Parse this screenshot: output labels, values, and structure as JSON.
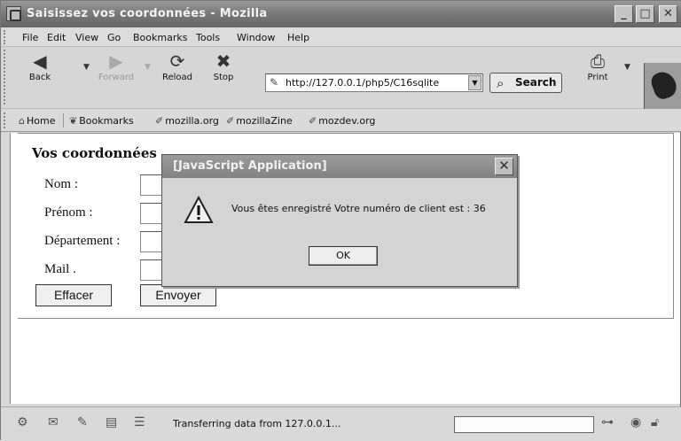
{
  "window": {
    "title": "Saisissez vos coordonnées - Mozilla"
  },
  "menu": {
    "items": [
      "File",
      "Edit",
      "View",
      "Go",
      "Bookmarks",
      "Tools",
      "Window",
      "Help"
    ]
  },
  "toolbar": {
    "back": "Back",
    "forward": "Forward",
    "reload": "Reload",
    "stop": "Stop",
    "url": "http://127.0.0.1/php5/C16sqlite",
    "search": "Search",
    "print": "Print"
  },
  "personal": {
    "items": [
      "Home",
      "Bookmarks",
      "mozilla.org",
      "mozillaZine",
      "mozdev.org"
    ]
  },
  "form": {
    "legend": "Vos coordonnées",
    "labels": [
      "Nom :",
      "Prénom :",
      "Département :",
      "Mail ."
    ],
    "reset": "Effacer",
    "submit": "Envoyer"
  },
  "dialog": {
    "title": "[JavaScript Application]",
    "message": "Vous êtes enregistré Votre numéro de client est : 36",
    "ok": "OK"
  },
  "status": {
    "text": "Transferring data from 127.0.0.1..."
  }
}
